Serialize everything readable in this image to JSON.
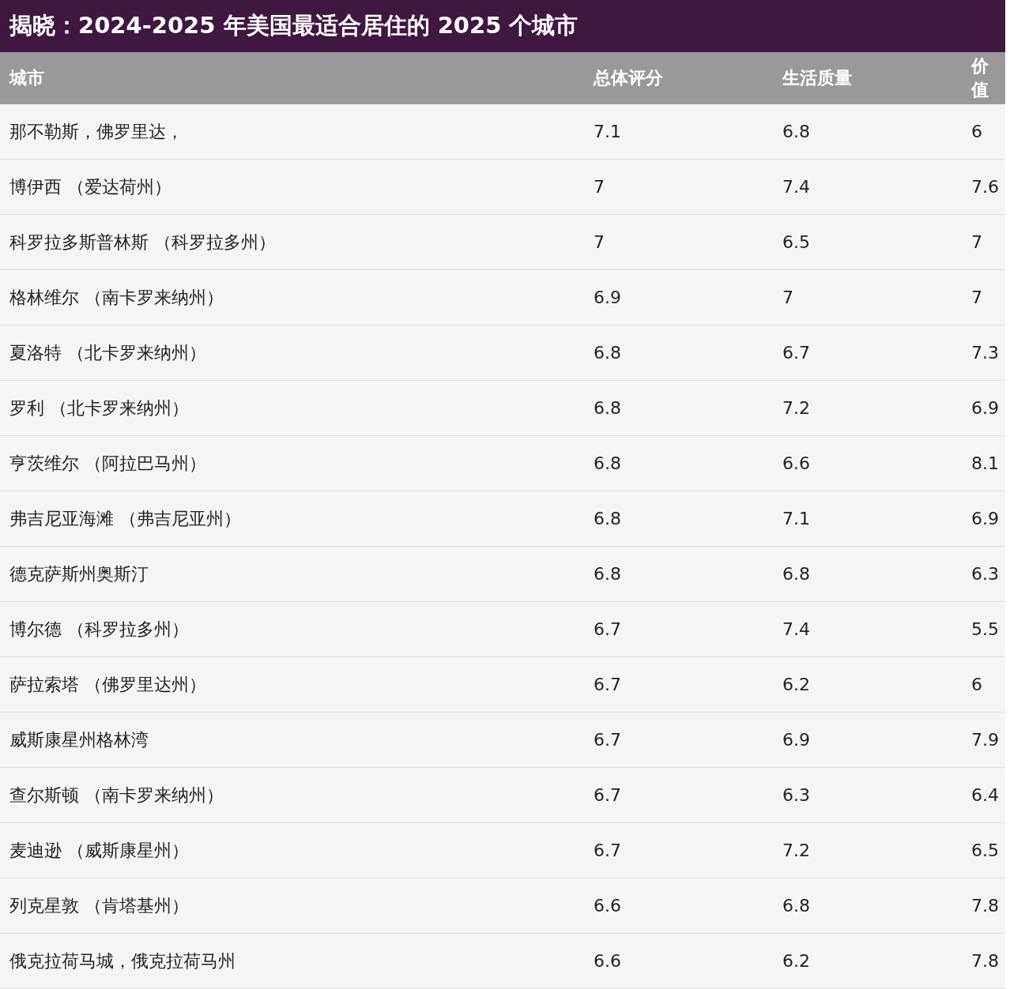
{
  "title": "揭晓：2024-2025 年美国最适合居住的 2025 个城市",
  "table": {
    "columns": [
      "城市",
      "总体评分",
      "生活质量",
      "价值"
    ],
    "rows": [
      [
        "那不勒斯，佛罗里达，",
        "7.1",
        "6.8",
        "6"
      ],
      [
        "博伊西 （爱达荷州）",
        "7",
        "7.4",
        "7.6"
      ],
      [
        "科罗拉多斯普林斯 （科罗拉多州）",
        "7",
        "6.5",
        "7"
      ],
      [
        "格林维尔 （南卡罗来纳州）",
        "6.9",
        "7",
        "7"
      ],
      [
        "夏洛特 （北卡罗来纳州）",
        "6.8",
        "6.7",
        "7.3"
      ],
      [
        "罗利 （北卡罗来纳州）",
        "6.8",
        "7.2",
        "6.9"
      ],
      [
        "亨茨维尔 （阿拉巴马州）",
        "6.8",
        "6.6",
        "8.1"
      ],
      [
        "弗吉尼亚海滩 （弗吉尼亚州）",
        "6.8",
        "7.1",
        "6.9"
      ],
      [
        "德克萨斯州奥斯汀",
        "6.8",
        "6.8",
        "6.3"
      ],
      [
        "博尔德 （科罗拉多州）",
        "6.7",
        "7.4",
        "5.5"
      ],
      [
        "萨拉索塔 （佛罗里达州）",
        "6.7",
        "6.2",
        "6"
      ],
      [
        "威斯康星州格林湾",
        "6.7",
        "6.9",
        "7.9"
      ],
      [
        "查尔斯顿 （南卡罗来纳州）",
        "6.7",
        "6.3",
        "6.4"
      ],
      [
        "麦迪逊 （威斯康星州）",
        "6.7",
        "7.2",
        "6.5"
      ],
      [
        "列克星敦 （肯塔基州）",
        "6.6",
        "6.8",
        "7.8"
      ],
      [
        "俄克拉荷马城，俄克拉荷马州",
        "6.6",
        "6.2",
        "7.8"
      ]
    ]
  }
}
